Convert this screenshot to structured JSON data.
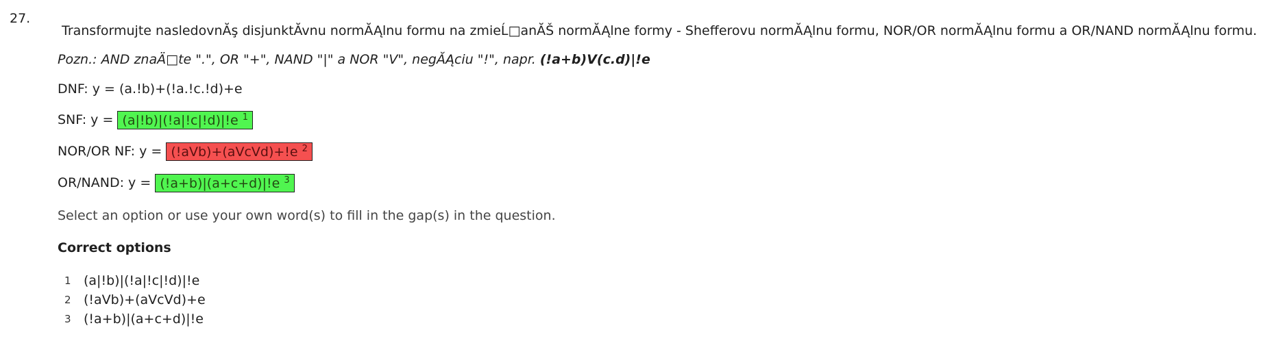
{
  "question": {
    "number": "27.",
    "instruction": "Transformujte nasledovnĂş disjunktĂvnu normĂĄlnu formu na zmieĹ□anĂŠ normĂĄlne formy - Shefferovu normĂĄlnu formu, NOR/OR normĂĄlnu formu a OR/NAND normĂĄlnu formu.",
    "note_prefix": "Pozn.: AND znaÄ□te \".\", OR \"+\", NAND \"|\" a NOR \"V\", negĂĄciu \"!\", napr.",
    "note_example": "(!a+b)V(c.d)|!e",
    "dnf_line": "DNF: y = (a.!b)+(!a.!c.!d)+e",
    "fields": [
      {
        "label": "SNF: y =",
        "answer": "(a|!b)|(!a|!c|!d)|!e",
        "gap_number": "1",
        "status": "correct"
      },
      {
        "label": "NOR/OR NF: y =",
        "answer": "(!aVb)+(aVcVd)+!e",
        "gap_number": "2",
        "status": "incorrect"
      },
      {
        "label": "OR/NAND: y =",
        "answer": "(!a+b)|(a+c+d)|!e",
        "gap_number": "3",
        "status": "correct"
      }
    ],
    "select_hint": "Select an option or use your own word(s) to fill in the gap(s) in the question."
  },
  "correct_options": {
    "heading": "Correct options",
    "items": [
      {
        "num": "1",
        "value": "(a|!b)|(!a|!c|!d)|!e"
      },
      {
        "num": "2",
        "value": "(!aVb)+(aVcVd)+e"
      },
      {
        "num": "3",
        "value": "(!a+b)|(a+c+d)|!e"
      }
    ]
  },
  "colors": {
    "correct": "#50f550",
    "incorrect": "#f55050"
  }
}
